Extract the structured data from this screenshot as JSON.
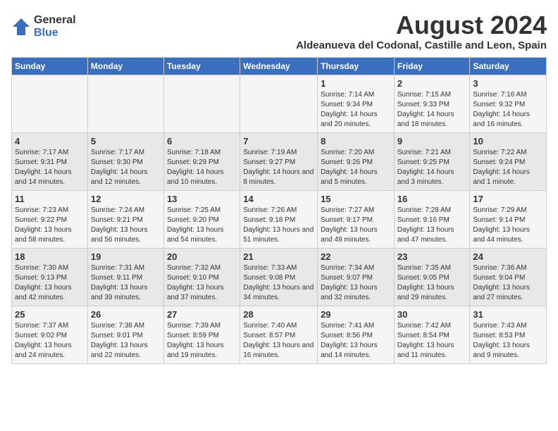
{
  "logo": {
    "general": "General",
    "blue": "Blue"
  },
  "title": "August 2024",
  "location": "Aldeanueva del Codonal, Castille and Leon, Spain",
  "headers": [
    "Sunday",
    "Monday",
    "Tuesday",
    "Wednesday",
    "Thursday",
    "Friday",
    "Saturday"
  ],
  "weeks": [
    [
      {
        "day": "",
        "info": ""
      },
      {
        "day": "",
        "info": ""
      },
      {
        "day": "",
        "info": ""
      },
      {
        "day": "",
        "info": ""
      },
      {
        "day": "1",
        "info": "Sunrise: 7:14 AM\nSunset: 9:34 PM\nDaylight: 14 hours and 20 minutes."
      },
      {
        "day": "2",
        "info": "Sunrise: 7:15 AM\nSunset: 9:33 PM\nDaylight: 14 hours and 18 minutes."
      },
      {
        "day": "3",
        "info": "Sunrise: 7:16 AM\nSunset: 9:32 PM\nDaylight: 14 hours and 16 minutes."
      }
    ],
    [
      {
        "day": "4",
        "info": "Sunrise: 7:17 AM\nSunset: 9:31 PM\nDaylight: 14 hours and 14 minutes."
      },
      {
        "day": "5",
        "info": "Sunrise: 7:17 AM\nSunset: 9:30 PM\nDaylight: 14 hours and 12 minutes."
      },
      {
        "day": "6",
        "info": "Sunrise: 7:18 AM\nSunset: 9:29 PM\nDaylight: 14 hours and 10 minutes."
      },
      {
        "day": "7",
        "info": "Sunrise: 7:19 AM\nSunset: 9:27 PM\nDaylight: 14 hours and 8 minutes."
      },
      {
        "day": "8",
        "info": "Sunrise: 7:20 AM\nSunset: 9:26 PM\nDaylight: 14 hours and 5 minutes."
      },
      {
        "day": "9",
        "info": "Sunrise: 7:21 AM\nSunset: 9:25 PM\nDaylight: 14 hours and 3 minutes."
      },
      {
        "day": "10",
        "info": "Sunrise: 7:22 AM\nSunset: 9:24 PM\nDaylight: 14 hours and 1 minute."
      }
    ],
    [
      {
        "day": "11",
        "info": "Sunrise: 7:23 AM\nSunset: 9:22 PM\nDaylight: 13 hours and 58 minutes."
      },
      {
        "day": "12",
        "info": "Sunrise: 7:24 AM\nSunset: 9:21 PM\nDaylight: 13 hours and 56 minutes."
      },
      {
        "day": "13",
        "info": "Sunrise: 7:25 AM\nSunset: 9:20 PM\nDaylight: 13 hours and 54 minutes."
      },
      {
        "day": "14",
        "info": "Sunrise: 7:26 AM\nSunset: 9:18 PM\nDaylight: 13 hours and 51 minutes."
      },
      {
        "day": "15",
        "info": "Sunrise: 7:27 AM\nSunset: 9:17 PM\nDaylight: 13 hours and 49 minutes."
      },
      {
        "day": "16",
        "info": "Sunrise: 7:28 AM\nSunset: 9:16 PM\nDaylight: 13 hours and 47 minutes."
      },
      {
        "day": "17",
        "info": "Sunrise: 7:29 AM\nSunset: 9:14 PM\nDaylight: 13 hours and 44 minutes."
      }
    ],
    [
      {
        "day": "18",
        "info": "Sunrise: 7:30 AM\nSunset: 9:13 PM\nDaylight: 13 hours and 42 minutes."
      },
      {
        "day": "19",
        "info": "Sunrise: 7:31 AM\nSunset: 9:11 PM\nDaylight: 13 hours and 39 minutes."
      },
      {
        "day": "20",
        "info": "Sunrise: 7:32 AM\nSunset: 9:10 PM\nDaylight: 13 hours and 37 minutes."
      },
      {
        "day": "21",
        "info": "Sunrise: 7:33 AM\nSunset: 9:08 PM\nDaylight: 13 hours and 34 minutes."
      },
      {
        "day": "22",
        "info": "Sunrise: 7:34 AM\nSunset: 9:07 PM\nDaylight: 13 hours and 32 minutes."
      },
      {
        "day": "23",
        "info": "Sunrise: 7:35 AM\nSunset: 9:05 PM\nDaylight: 13 hours and 29 minutes."
      },
      {
        "day": "24",
        "info": "Sunrise: 7:36 AM\nSunset: 9:04 PM\nDaylight: 13 hours and 27 minutes."
      }
    ],
    [
      {
        "day": "25",
        "info": "Sunrise: 7:37 AM\nSunset: 9:02 PM\nDaylight: 13 hours and 24 minutes."
      },
      {
        "day": "26",
        "info": "Sunrise: 7:38 AM\nSunset: 9:01 PM\nDaylight: 13 hours and 22 minutes."
      },
      {
        "day": "27",
        "info": "Sunrise: 7:39 AM\nSunset: 8:59 PM\nDaylight: 13 hours and 19 minutes."
      },
      {
        "day": "28",
        "info": "Sunrise: 7:40 AM\nSunset: 8:57 PM\nDaylight: 13 hours and 16 minutes."
      },
      {
        "day": "29",
        "info": "Sunrise: 7:41 AM\nSunset: 8:56 PM\nDaylight: 13 hours and 14 minutes."
      },
      {
        "day": "30",
        "info": "Sunrise: 7:42 AM\nSunset: 8:54 PM\nDaylight: 13 hours and 11 minutes."
      },
      {
        "day": "31",
        "info": "Sunrise: 7:43 AM\nSunset: 8:53 PM\nDaylight: 13 hours and 9 minutes."
      }
    ]
  ]
}
